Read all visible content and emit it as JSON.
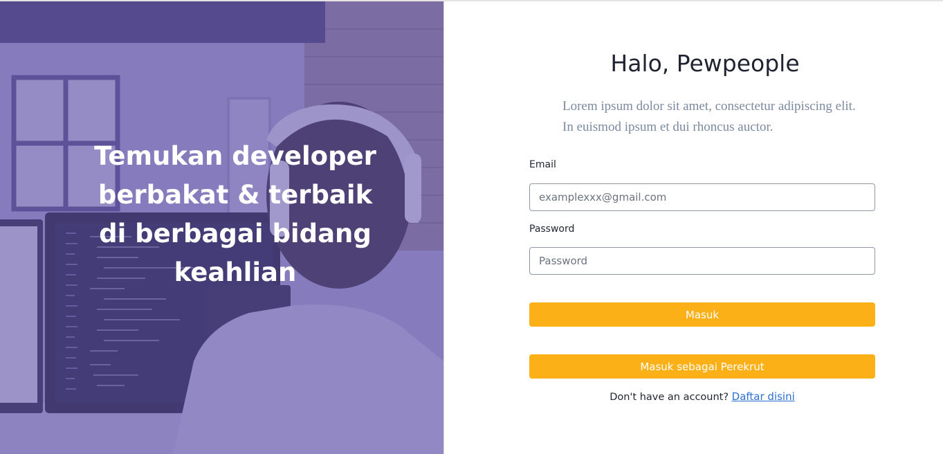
{
  "hero": {
    "headline": "Temukan developer berbakat & terbaik di berbagai bidang keahlian"
  },
  "login": {
    "title": "Halo, Pewpeople",
    "description": "Lorem ipsum dolor sit amet, consectetur adipiscing elit. In euismod ipsum et dui rhoncus auctor.",
    "email_label": "Email",
    "email_placeholder": "examplexxx@gmail.com",
    "password_label": "Password",
    "password_placeholder": "Password",
    "submit_label": "Masuk",
    "recruiter_label": "Masuk sebagai Perekrut",
    "signup_prompt": "Don't have an account?",
    "signup_link": "Daftar disini"
  },
  "colors": {
    "hero_overlay": "#5e50a8",
    "button": "#fbb017",
    "link": "#2b6fd6",
    "muted_text": "#7b8aa0"
  }
}
